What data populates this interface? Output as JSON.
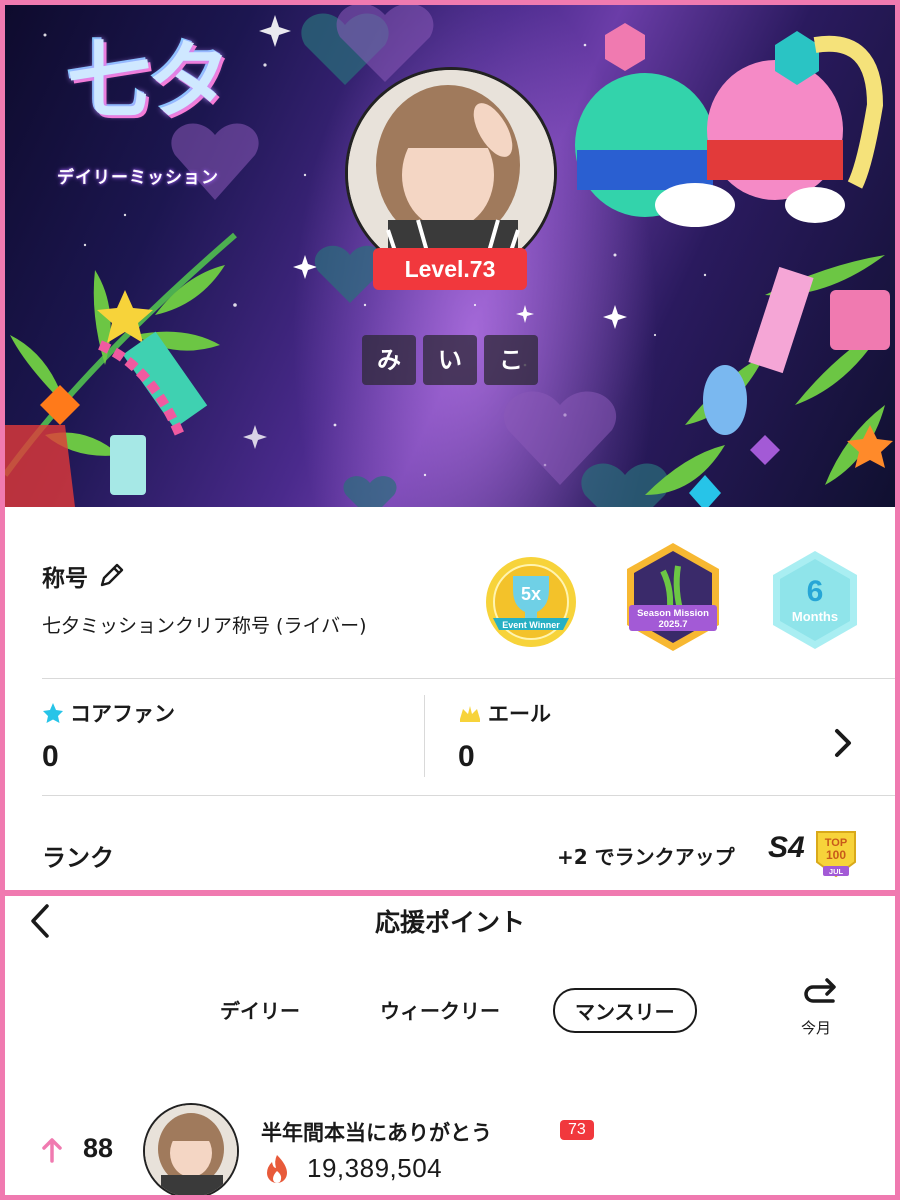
{
  "banner": {
    "logo_title": "七タ",
    "logo_subtitle": "デイリーミッション",
    "level": "Level.73",
    "name_chars": [
      "み",
      "い",
      "こ"
    ]
  },
  "title_section": {
    "label": "称号",
    "value": "七夕ミッションクリア称号 (ライバー)",
    "badges": [
      {
        "name": "event-winner",
        "big": "5x",
        "text": "Event Winner"
      },
      {
        "name": "season-mission",
        "text": "Season Mission",
        "date": "2025.7"
      },
      {
        "name": "months",
        "big": "6",
        "text": "Months"
      }
    ]
  },
  "stats": {
    "core_fan": {
      "label": "コアファン",
      "value": "0"
    },
    "yell": {
      "label": "エール",
      "value": "0"
    }
  },
  "rank": {
    "label": "ランク",
    "up_text": "+2 でランクアップ",
    "tier": "S4",
    "top_badge_line1": "TOP",
    "top_badge_line2": "100",
    "top_badge_month": "JUL"
  },
  "support": {
    "title": "応援ポイント",
    "tabs": [
      "デイリー",
      "ウィークリー",
      "マンスリー"
    ],
    "active_tab": "マンスリー",
    "reset_label": "今月",
    "rows": [
      {
        "rank": "88",
        "name": "半年間本当にありがとう",
        "level": "73",
        "points": "19,389,504"
      }
    ]
  },
  "colors": {
    "accent_pink": "#f07ab0",
    "level_red": "#f1383d",
    "star_cyan": "#27c4e8",
    "yell_yellow": "#f7d33a"
  }
}
